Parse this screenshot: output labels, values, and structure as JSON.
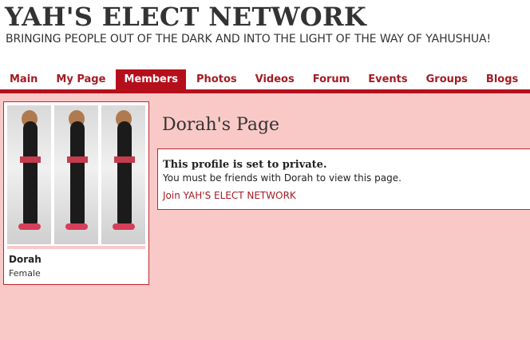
{
  "site": {
    "title": "YAH'S ELECT NETWORK",
    "tagline": "BRINGING PEOPLE OUT OF THE DARK AND INTO THE LIGHT OF THE WAY OF YAHUSHUA!"
  },
  "nav": {
    "items": [
      {
        "label": "Main"
      },
      {
        "label": "My Page"
      },
      {
        "label": "Members"
      },
      {
        "label": "Photos"
      },
      {
        "label": "Videos"
      },
      {
        "label": "Forum"
      },
      {
        "label": "Events"
      },
      {
        "label": "Groups"
      },
      {
        "label": "Blogs"
      }
    ],
    "active": "Members"
  },
  "profile": {
    "name": "Dorah",
    "gender": "Female"
  },
  "page": {
    "heading": "Dorah's Page"
  },
  "privacy": {
    "title": "This profile is set to private.",
    "message": "You must be friends with Dorah to view this page.",
    "join_link": "Join YAH'S ELECT NETWORK"
  },
  "colors": {
    "accent": "#b50f1c",
    "link": "#a31c24",
    "background": "#f9c9c8",
    "border": "#c2272d"
  }
}
